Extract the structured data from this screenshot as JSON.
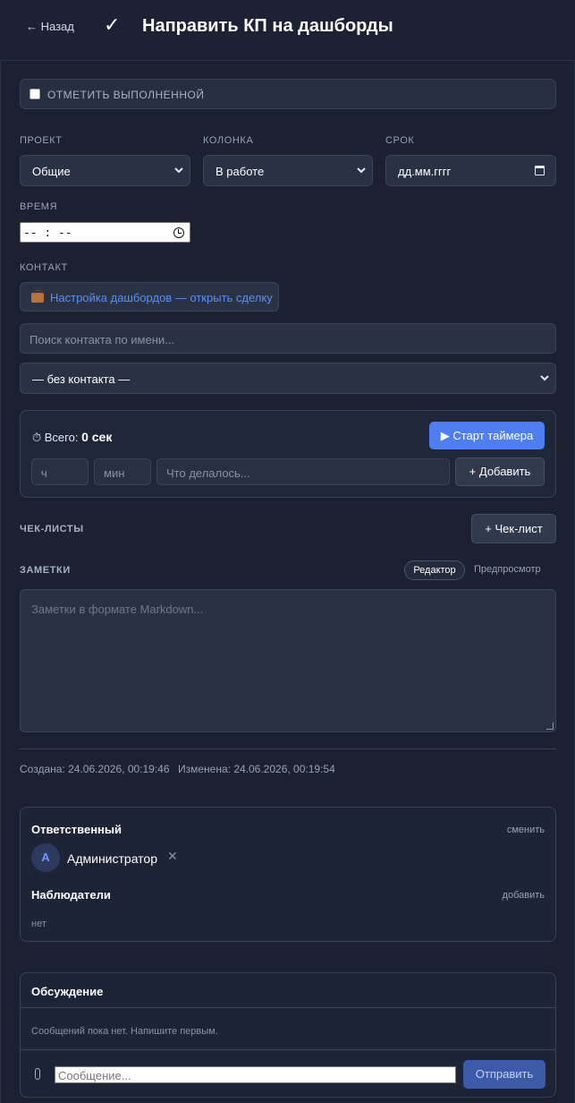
{
  "header": {
    "back_label": "← Назад",
    "check_glyph": "✓",
    "title": "Направить КП на дашборды"
  },
  "done": {
    "label": "ОТМЕТИТЬ ВЫПОЛНЕННОЙ",
    "checked": false
  },
  "fields": {
    "project": {
      "label": "ПРОЕКТ",
      "value": "Общие"
    },
    "column": {
      "label": "КОЛОНКА",
      "value": "В работе"
    },
    "deadline": {
      "label": "СРОК",
      "value": "дд.мм.гггг"
    },
    "time": {
      "label": "ВРЕМЯ",
      "value": "-- : --"
    }
  },
  "contact": {
    "label": "КОНТАКТ",
    "deal_link": "Настройка дашбордов — открыть сделку",
    "search_placeholder": "Поиск контакта по имени...",
    "select_value": "— без контакта —"
  },
  "timer": {
    "total_prefix": "⏱ Всего:",
    "total_value": "0 сек",
    "start_label": "▶ Старт таймера",
    "hours_placeholder": "ч",
    "minutes_placeholder": "мин",
    "what_placeholder": "Что делалось...",
    "add_label": "+ Добавить"
  },
  "checklists": {
    "label": "ЧЕК-ЛИСТЫ",
    "add_label": "+ Чек-лист"
  },
  "notes": {
    "label": "ЗАМЕТКИ",
    "tab_editor": "Редактор",
    "tab_preview": "Предпросмотр",
    "placeholder": "Заметки в формате Markdown..."
  },
  "meta": {
    "created": "Создана: 24.06.2026, 00:19:46",
    "modified": "Изменена: 24.06.2026, 00:19:54"
  },
  "people": {
    "responsible_title": "Ответственный",
    "change_label": "сменить",
    "avatar_letter": "А",
    "user_name": "Администратор",
    "remove_glyph": "✕",
    "watchers_title": "Наблюдатели",
    "add_label": "добавить",
    "watchers_empty": "нет"
  },
  "discussion": {
    "title": "Обсуждение",
    "empty_text": "Сообщений пока нет. Напишите первым.",
    "message_placeholder": "Сообщение...",
    "send_label": "Отправить"
  },
  "colors": {
    "accent": "#4f7ef0",
    "background": "#1b2131",
    "link": "#5a8ef5"
  }
}
